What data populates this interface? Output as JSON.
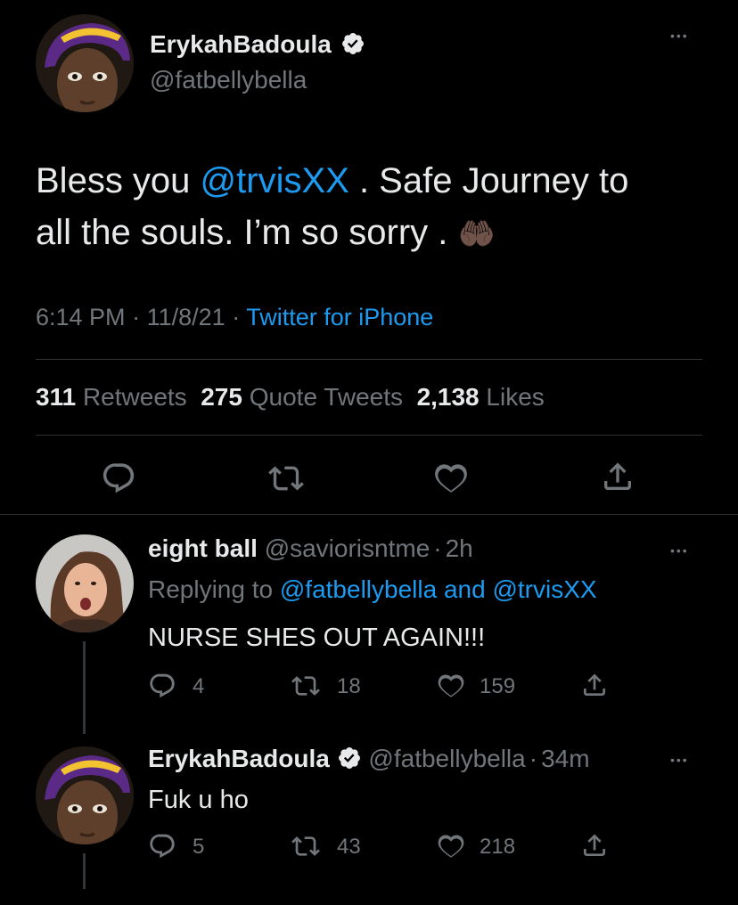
{
  "main_tweet": {
    "display_name": "ErykahBadoula",
    "handle": "@fatbellybella",
    "text_parts": [
      "Bless you ",
      "@trvisXX",
      " . Safe Journey to",
      "all the souls. I’m so sorry . ",
      "🤲🏿"
    ],
    "time": "6:14 PM",
    "date": "11/8/21",
    "source": "Twitter for iPhone",
    "stats": {
      "retweets": "311",
      "retweets_label": "Retweets",
      "quotes": "275",
      "quotes_label": "Quote Tweets",
      "likes": "2,138",
      "likes_label": "Likes"
    }
  },
  "replies": [
    {
      "display_name": "eight ball",
      "handle": "@saviorisntme",
      "age": "2h",
      "replying_prefix": "Replying to ",
      "replying_user1": "@fatbellybella",
      "replying_and": " and ",
      "replying_user2": "@trvisXX",
      "text": "NURSE SHES OUT AGAIN!!!",
      "replies": "4",
      "retweets": "18",
      "likes": "159"
    },
    {
      "display_name": "ErykahBadoula",
      "handle": "@fatbellybella",
      "age": "34m",
      "text": "Fuk u ho",
      "replies": "5",
      "retweets": "43",
      "likes": "218"
    }
  ],
  "separator": "·",
  "more_glyph": "•••",
  "colors": {
    "background": "#000000",
    "text": "#e7e9ea",
    "muted": "#71767b",
    "accent": "#1d9bf0",
    "divider": "#2f3336",
    "hat_purple": "#5b2a86",
    "hat_yellow": "#f2c230"
  },
  "icons": {
    "reply": "reply-icon",
    "retweet": "retweet-icon",
    "like": "heart-icon",
    "share": "share-icon",
    "more": "more-icon",
    "verified": "verified-badge-icon"
  }
}
